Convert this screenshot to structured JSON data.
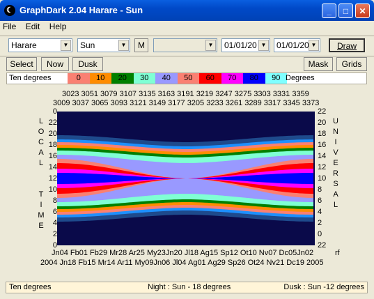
{
  "window": {
    "title": "GraphDark 2.04  Harare  -  Sun"
  },
  "menu": [
    "File",
    "Edit",
    "Help"
  ],
  "toolbar": {
    "location": "Harare",
    "body": "Sun",
    "m_label": "M",
    "blank_combo": "",
    "date_from": "01/01/20",
    "date_to": "01/01/20",
    "draw_label": "Draw"
  },
  "toolbar2": {
    "select_label": "Select",
    "now_label": "Now",
    "dusk_label": "Dusk",
    "mask_label": "Mask",
    "grids_label": "Grids"
  },
  "legend": {
    "left_label": "Ten degrees",
    "right_label": "Degrees",
    "steps": [
      {
        "label": "0",
        "color": "#FA8072"
      },
      {
        "label": "10",
        "color": "#FF8C00"
      },
      {
        "label": "20",
        "color": "#008000"
      },
      {
        "label": "30",
        "color": "#7FFFD4"
      },
      {
        "label": "40",
        "color": "#9999FF"
      },
      {
        "label": "50",
        "color": "#FA8072"
      },
      {
        "label": "60",
        "color": "#FF0000"
      },
      {
        "label": "70",
        "color": "#FF00FF"
      },
      {
        "label": "80",
        "color": "#0000FF"
      },
      {
        "label": "90",
        "color": "#7FFFFF"
      }
    ]
  },
  "chart": {
    "top_row1": "3023 3051 3079 3107 3135 3163 3191 3219 3247 3275 3303 3331 3359",
    "top_row2": "3009 3037 3065 3093 3121 3149 3177 3205 3233 3261 3289 3317 3345 3373",
    "left_title": "LOCAL  TIME",
    "right_title": "UNIVERSAL",
    "left_ticks": [
      "0",
      "22",
      "20",
      "18",
      "16",
      "14",
      "12",
      "10",
      "8",
      "6",
      "4",
      "2",
      "0"
    ],
    "right_ticks": [
      "22",
      "20",
      "18",
      "16",
      "14",
      "12",
      "10",
      "8",
      "6",
      "4",
      "2",
      "0",
      "22"
    ],
    "bottom_row1": "Jn04 Fb01 Fb29 Mr28 Ar25 My23Jn20 Jl18  Ag15 Sp12 Ot10 Nv07 Dc05Jn02",
    "bottom_row1_tail": "rf",
    "bottom_row2": "2004  Jn18 Fb15 Mr14 Ar11  My09Jn06 Jl04  Ag01 Ag29 Sp26 Ot24 Nv21 Dc19  2005"
  },
  "status": {
    "left": "Ten degrees",
    "mid": "Night : Sun - 18 degrees",
    "right": "Dusk : Sun -12 degrees"
  },
  "colors": {
    "night": "#0A0A4A",
    "band_blue": "#1E90FF"
  }
}
